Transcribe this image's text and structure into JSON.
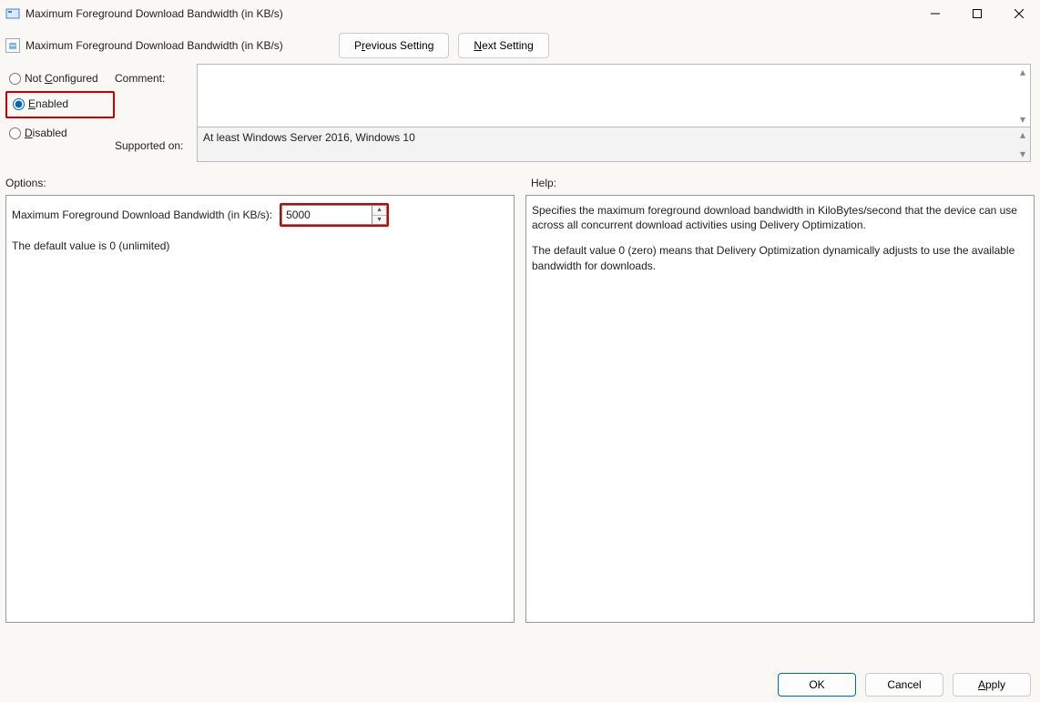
{
  "window": {
    "title": "Maximum Foreground Download Bandwidth (in KB/s)"
  },
  "header": {
    "subtitle": "Maximum Foreground Download Bandwidth (in KB/s)",
    "prev_btn": {
      "pre": "P",
      "ul": "r",
      "post": "evious Setting"
    },
    "next_btn": {
      "pre": "",
      "ul": "N",
      "post": "ext Setting"
    }
  },
  "radios": {
    "not_configured": {
      "pre": "Not ",
      "ul": "C",
      "post": "onfigured"
    },
    "enabled": {
      "pre": "",
      "ul": "E",
      "post": "nabled"
    },
    "disabled": {
      "pre": "",
      "ul": "D",
      "post": "isabled"
    },
    "selected": "enabled"
  },
  "labels": {
    "comment": "Comment:",
    "supported_on": "Supported on:"
  },
  "supported_text": "At least Windows Server 2016, Windows 10",
  "sections": {
    "options": "Options:",
    "help": "Help:"
  },
  "options": {
    "bandwidth_label": "Maximum Foreground Download Bandwidth (in KB/s):",
    "bandwidth_value": "5000",
    "default_note": "The default value is 0 (unlimited)"
  },
  "help": {
    "p1": "Specifies the maximum foreground download bandwidth in KiloBytes/second that the device can use across all concurrent download activities using Delivery Optimization.",
    "p2": "The default value 0 (zero) means that Delivery Optimization dynamically adjusts to use the available bandwidth for downloads."
  },
  "footer": {
    "ok": "OK",
    "cancel": "Cancel",
    "apply": {
      "pre": "",
      "ul": "A",
      "post": "pply"
    }
  }
}
